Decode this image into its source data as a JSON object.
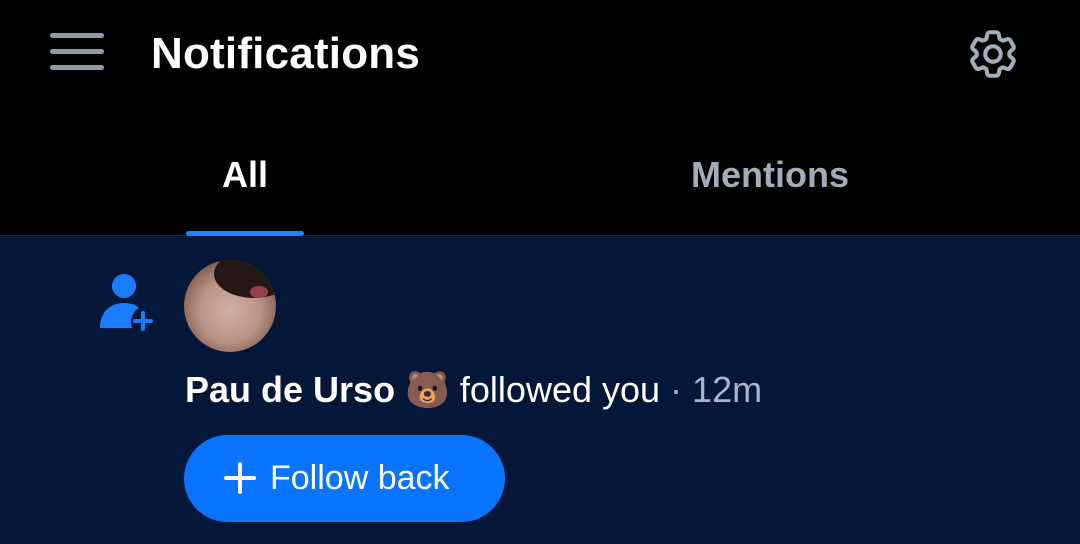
{
  "header": {
    "title": "Notifications",
    "menu_icon": "hamburger-menu-icon",
    "settings_icon": "gear-icon"
  },
  "tabs": [
    {
      "label": "All",
      "selected": true
    },
    {
      "label": "Mentions",
      "selected": false
    }
  ],
  "notifications": [
    {
      "type_icon": "person-add-icon",
      "avatar": "user-avatar",
      "user_name": "Pau de Urso 🐻",
      "action": "followed you",
      "separator": " · ",
      "time": "12m",
      "button_icon": "plus-icon",
      "button_label": "Follow back"
    }
  ],
  "colors": {
    "accent": "#0a74ff",
    "tab_indicator": "#1a85ff",
    "header_bg": "#000000",
    "feed_bg": "#051738",
    "muted_text": "#a8b5c8"
  }
}
